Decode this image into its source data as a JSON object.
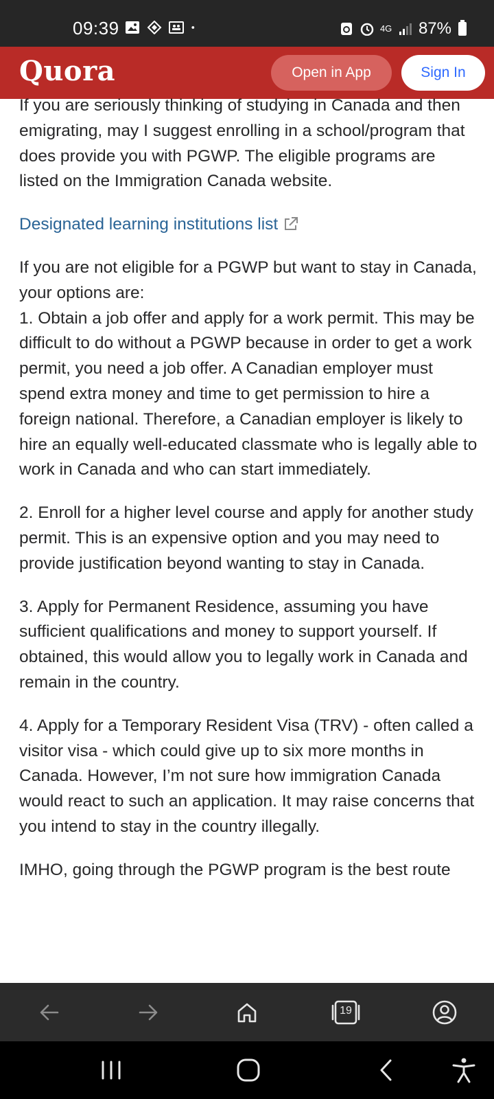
{
  "status_bar": {
    "time": "09:39",
    "battery": "87%",
    "network": "4G",
    "icons": [
      "image-icon",
      "vpn-icon",
      "teams-icon",
      "dot-icon",
      "recycle-icon",
      "alarm-icon",
      "signal-icon",
      "battery-icon"
    ]
  },
  "header": {
    "logo": "Quora",
    "open_in_app": "Open in App",
    "sign_in": "Sign In",
    "brand_color": "#b92b27",
    "sign_in_color": "#2e69ff"
  },
  "article": {
    "paragraph_1": "If you are seriously thinking of studying in Canada and then emigrating, may I suggest enrolling in a school/program that does provide you with PGWP. The eligible programs are listed on the Immigration Canada website.",
    "link_text": "Designated learning institutions list",
    "paragraph_2_intro": "If you are not eligible for a PGWP but want to stay in Canada, your options are:",
    "option_1": "1. Obtain a job offer and apply for a work permit. This may be difficult to do without a PGWP because in order to get a work permit, you need a job offer. A Canadian employer must spend extra money and time to get permission to hire a foreign national. Therefore, a Canadian employer is likely to hire an equally well-educated classmate who is legally able to work in Canada and who can start immediately.",
    "option_2": "2. Enroll for a higher level course and apply for another study permit. This is an expensive option and you may need to provide justification beyond wanting to stay in Canada.",
    "option_3": "3. Apply for Permanent Residence, assuming you have sufficient qualifications and money to support yourself. If obtained, this would allow you to legally work in Canada and remain in the country.",
    "option_4": "4. Apply for a Temporary Resident Visa (TRV) - often called a visitor visa - which could give up to six more months in Canada. However, I’m not sure how immigration Canada would react to such an application. It may raise concerns that you intend to stay in the country illegally.",
    "closing": "IMHO, going through the PGWP program is the best route",
    "link_color": "#2a6496"
  },
  "browser_nav": {
    "tab_count": "19",
    "icons": [
      "back-icon",
      "forward-icon",
      "home-icon",
      "tabs-icon",
      "account-icon"
    ]
  },
  "system_nav": {
    "icons": [
      "recents-icon",
      "home-circle-icon",
      "back-chevron-icon",
      "accessibility-icon"
    ]
  }
}
